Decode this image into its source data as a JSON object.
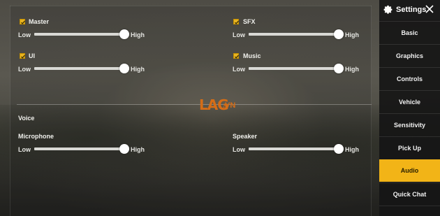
{
  "header": {
    "title": "Settings",
    "settings_icon": "gear-icon",
    "close_icon": "close-icon"
  },
  "menu": [
    {
      "label": "Basic",
      "active": false
    },
    {
      "label": "Graphics",
      "active": false
    },
    {
      "label": "Controls",
      "active": false
    },
    {
      "label": "Vehicle",
      "active": false
    },
    {
      "label": "Sensitivity",
      "active": false
    },
    {
      "label": "Pick Up",
      "active": false
    },
    {
      "label": "Audio",
      "active": true
    },
    {
      "label": "Quick Chat",
      "active": false
    }
  ],
  "audio": {
    "master": {
      "label": "Master",
      "checked": true,
      "low": "Low",
      "high": "High",
      "value": 1.0
    },
    "sfx": {
      "label": "SFX",
      "checked": true,
      "low": "Low",
      "high": "High",
      "value": 1.0
    },
    "ui": {
      "label": "UI",
      "checked": true,
      "low": "Low",
      "high": "High",
      "value": 1.0
    },
    "music": {
      "label": "Music",
      "checked": true,
      "low": "Low",
      "high": "High",
      "value": 1.0
    },
    "voice_section": "Voice",
    "microphone": {
      "label": "Microphone",
      "low": "Low",
      "high": "High",
      "value": 1.0
    },
    "speaker": {
      "label": "Speaker",
      "low": "Low",
      "high": "High",
      "value": 1.0
    }
  },
  "watermark": {
    "main": "LAG",
    "suffix": ".VN"
  },
  "colors": {
    "accent": "#f2b417",
    "checkbox": "#e7b320",
    "watermark": "#d56d17"
  }
}
